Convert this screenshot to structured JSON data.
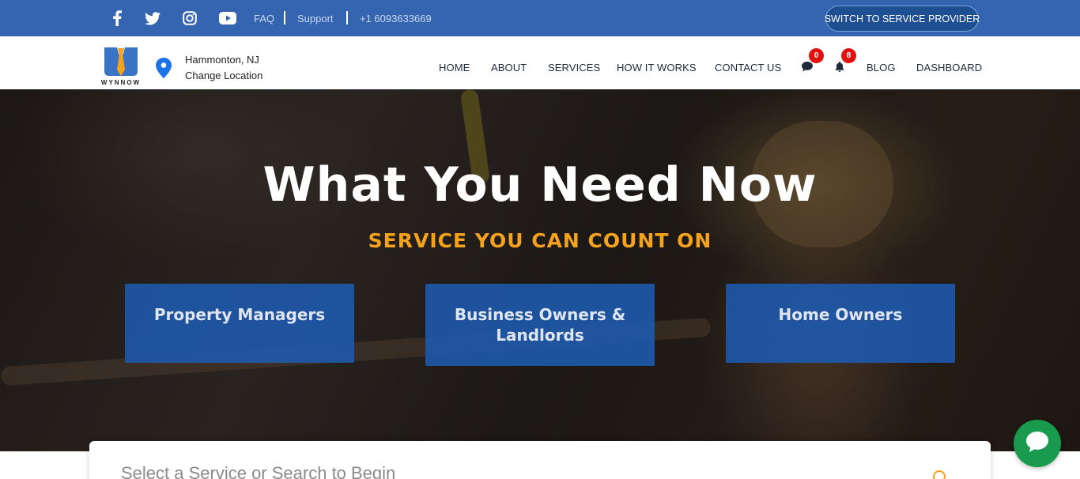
{
  "topbar": {
    "social_icons": [
      "facebook-icon",
      "twitter-icon",
      "instagram-icon",
      "youtube-icon"
    ],
    "links": {
      "faq": "FAQ",
      "support": "Support",
      "phone": "+1 6093633669"
    },
    "switch_button": "SWITCH TO SERVICE PROVIDER"
  },
  "header": {
    "logo_text": "WYNNOW",
    "location": {
      "icon": "map-pin-icon",
      "city": "Hammonton, NJ",
      "change_label": "Change Location"
    },
    "nav": {
      "home": "HOME",
      "about": "ABOUT",
      "services": "SERVICES",
      "how_it_works": "HOW IT WORKS",
      "contact_us": "CONTACT US",
      "blog": "BLOG",
      "dashboard": "DASHBOARD"
    },
    "messages": {
      "icon": "chat-bubble-icon",
      "count": "0"
    },
    "notifications": {
      "icon": "bell-icon",
      "count": "8"
    }
  },
  "hero": {
    "title": "What You Need Now",
    "subtitle": "SERVICE YOU CAN COUNT ON",
    "cards": {
      "property": "Property Managers",
      "business": "Business Owners & Landlords",
      "home": "Home Owners"
    }
  },
  "search": {
    "placeholder": "Select a Service or Search to Begin",
    "icon": "search-icon"
  },
  "chat": {
    "icon": "chat-icon"
  },
  "colors": {
    "topbar": "#3565b1",
    "accent_orange": "#f5a21c",
    "card_blue": "#1e5aaf",
    "badge_red": "#e31010",
    "chat_green": "#1a9a4e"
  }
}
